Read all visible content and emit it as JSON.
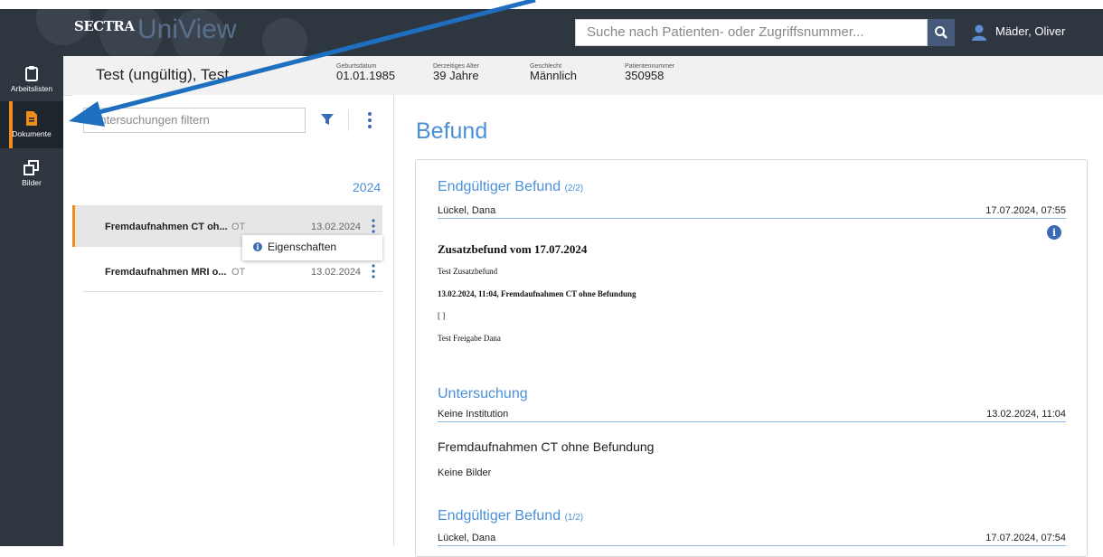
{
  "header": {
    "brand": "SECTRA",
    "product": "UniView",
    "search_placeholder": "Suche nach Patienten- oder Zugriffsnummer...",
    "user": "Mäder, Oliver"
  },
  "sidebar": {
    "items": [
      {
        "label": "Arbeitslisten",
        "icon": "clipboard-icon"
      },
      {
        "label": "Dokumente",
        "icon": "document-icon"
      },
      {
        "label": "Bilder",
        "icon": "images-icon"
      }
    ],
    "active_color": "#f08c1e"
  },
  "patient": {
    "name": "Test (ungültig), Test",
    "fields": [
      {
        "label": "Geburtsdatum",
        "value": "01.01.1985"
      },
      {
        "label": "Derzeitiges Alter",
        "value": "39 Jahre"
      },
      {
        "label": "Geschlecht",
        "value": "Männlich"
      },
      {
        "label": "Patientennummer",
        "value": "350958"
      }
    ]
  },
  "studies": {
    "filter_placeholder": "Untersuchungen filtern",
    "year": "2024",
    "items": [
      {
        "title": "Fremdaufnahmen CT oh...",
        "modality": "OT",
        "date": "13.02.2024"
      },
      {
        "title": "Fremdaufnahmen MRI o...",
        "modality": "OT",
        "date": "13.02.2024"
      }
    ],
    "context_menu": {
      "item": "Eigenschaften"
    }
  },
  "report": {
    "heading": "Befund",
    "final1": {
      "title": "Endgültiger Befund",
      "count": "(2/2)",
      "author": "Lückel, Dana",
      "timestamp": "17.07.2024, 07:55"
    },
    "doc": {
      "heading": "Zusatzbefund vom 17.07.2024",
      "line1": "Test Zusatzbefund",
      "line2": "13.02.2024, 11:04, Fremdaufnahmen CT ohne Befundung",
      "line3": "[ ]",
      "line4": "Test Freigabe Dana"
    },
    "exam": {
      "title": "Untersuchung",
      "institution": "Keine Institution",
      "timestamp": "13.02.2024, 11:04",
      "name": "Fremdaufnahmen CT ohne Befundung",
      "images": "Keine Bilder"
    },
    "final2": {
      "title": "Endgültiger Befund",
      "count": "(1/2)",
      "author": "Lückel, Dana",
      "timestamp": "17.07.2024, 07:54"
    }
  },
  "colors": {
    "accent": "#4a90d9",
    "topbar": "#2e3640",
    "annotation_arrow": "#1f6fc0"
  }
}
